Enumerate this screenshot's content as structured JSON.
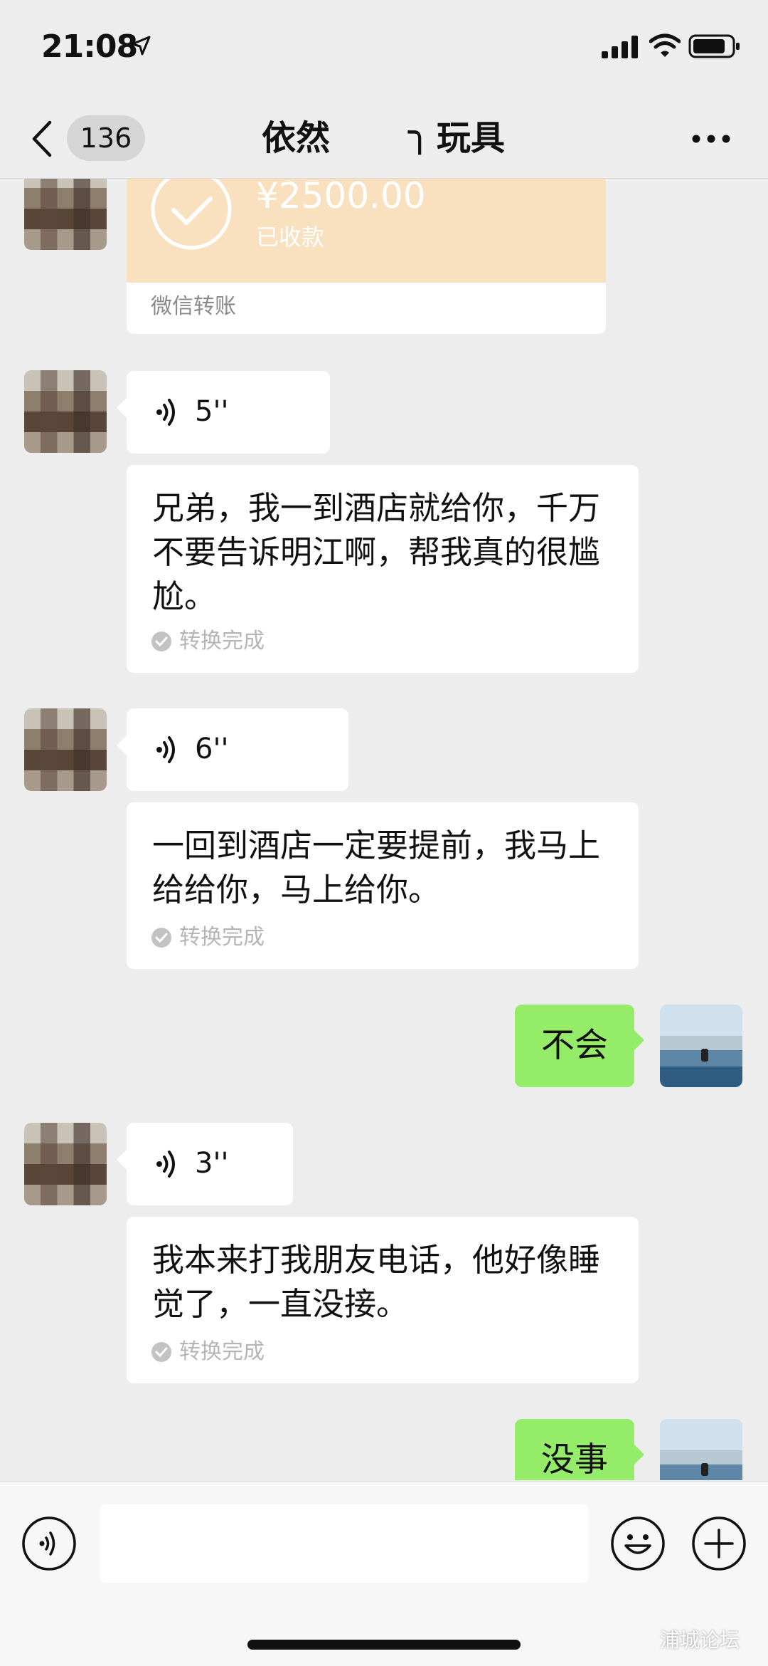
{
  "status": {
    "time": "21:08"
  },
  "nav": {
    "back_count": "136",
    "title_part1": "依然",
    "title_mark": "╮",
    "title_part2": "玩具"
  },
  "transfer": {
    "amount": "¥2500.00",
    "status": "已收款",
    "label": "微信转账"
  },
  "messages": [
    {
      "type": "voice",
      "duration": "5''",
      "transcript": "兄弟，我一到酒店就给你，千万不要告诉明江啊，帮我真的很尴尬。",
      "status": "转换完成"
    },
    {
      "type": "voice",
      "duration": "6''",
      "transcript": "一回到酒店一定要提前，我马上给给你，马上给你。",
      "status": "转换完成"
    },
    {
      "type": "text_out",
      "text": "不会"
    },
    {
      "type": "voice",
      "duration": "3''",
      "transcript": "我本来打我朋友电话，他好像睡觉了，一直没接。",
      "status": "转换完成"
    },
    {
      "type": "text_out",
      "text": "没事"
    }
  ],
  "input": {
    "placeholder": ""
  },
  "watermark": "浦城论坛",
  "colors": {
    "background": "#ededed",
    "outgoing_bubble": "#95ec69",
    "transfer_card": "#f9e1c0"
  }
}
